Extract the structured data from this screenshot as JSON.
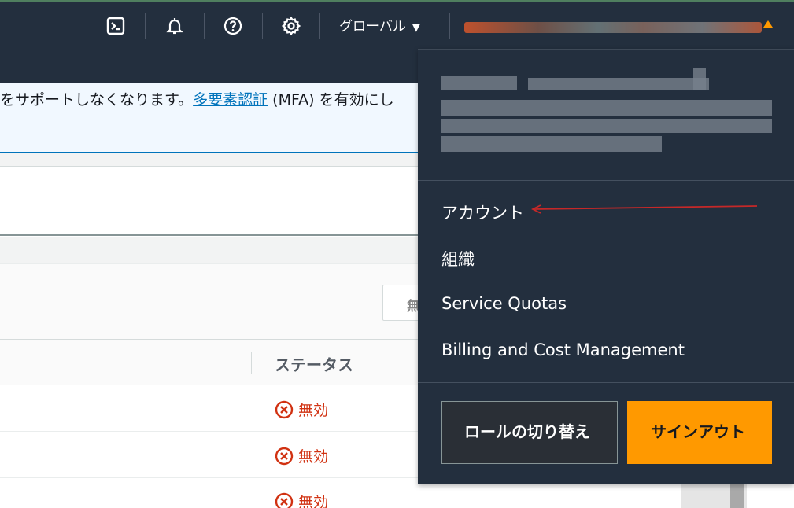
{
  "nav": {
    "icons": [
      "cloudshell-icon",
      "bell-icon",
      "help-icon",
      "gear-icon"
    ],
    "region_label": "グローバル",
    "region_caret": "▼"
  },
  "banner": {
    "text_before": "をサポートしなくなります。",
    "link_text": "多要素認証",
    "text_after": " (MFA) を有効にし"
  },
  "table": {
    "filter_label": "無",
    "status_header": "ステータス",
    "rows": [
      {
        "status": "無効"
      },
      {
        "status": "無効"
      },
      {
        "status": "無効"
      }
    ]
  },
  "dropdown": {
    "items": [
      "アカウント",
      "組織",
      "Service Quotas",
      "Billing and Cost Management"
    ],
    "switch_role_label": "ロールの切り替え",
    "sign_out_label": "サインアウト"
  },
  "colors": {
    "nav_bg": "#232f3e",
    "accent_orange": "#ff9900",
    "link_blue": "#0073bb",
    "error_red": "#d13212",
    "annotation_arrow": "#c62828"
  }
}
